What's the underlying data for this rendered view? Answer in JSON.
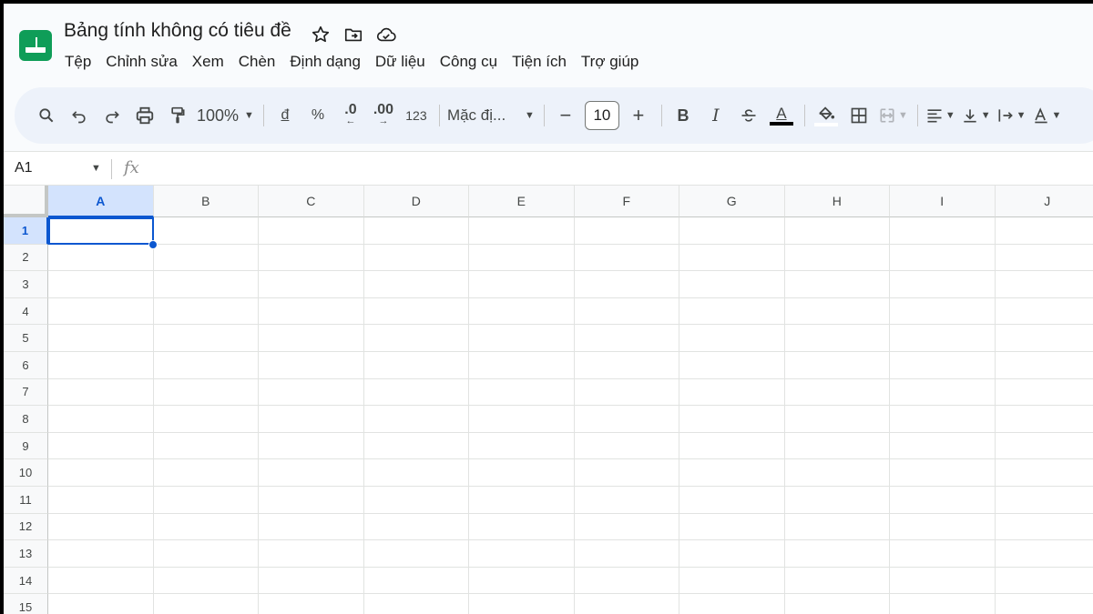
{
  "app": {
    "doc_title": "Bảng tính không có tiêu đề",
    "menu": [
      "Tệp",
      "Chỉnh sửa",
      "Xem",
      "Chèn",
      "Định dạng",
      "Dữ liệu",
      "Công cụ",
      "Tiện ích",
      "Trợ giúp"
    ]
  },
  "toolbar": {
    "zoom": "100%",
    "currency": "đ",
    "percent": "%",
    "dec_decrease": ".0",
    "dec_increase": ".00",
    "more_formats": "123",
    "font": "Mặc đị...",
    "font_size": "10",
    "bold": "B",
    "italic": "I",
    "text_color_letter": "A"
  },
  "formula_bar": {
    "name_box": "A1",
    "fx_label": "fx"
  },
  "grid": {
    "columns": [
      "A",
      "B",
      "C",
      "D",
      "E",
      "F",
      "G",
      "H",
      "I",
      "J"
    ],
    "rows": [
      "1",
      "2",
      "3",
      "4",
      "5",
      "6",
      "7",
      "8",
      "9",
      "10",
      "11",
      "12",
      "13",
      "14",
      "15"
    ],
    "selected_cell": "A1"
  },
  "colors": {
    "accent": "#0b57d0",
    "logo_green": "#0f9d58",
    "selected_header": "#d3e3fd",
    "toolbar_bg": "#edf2fa"
  }
}
